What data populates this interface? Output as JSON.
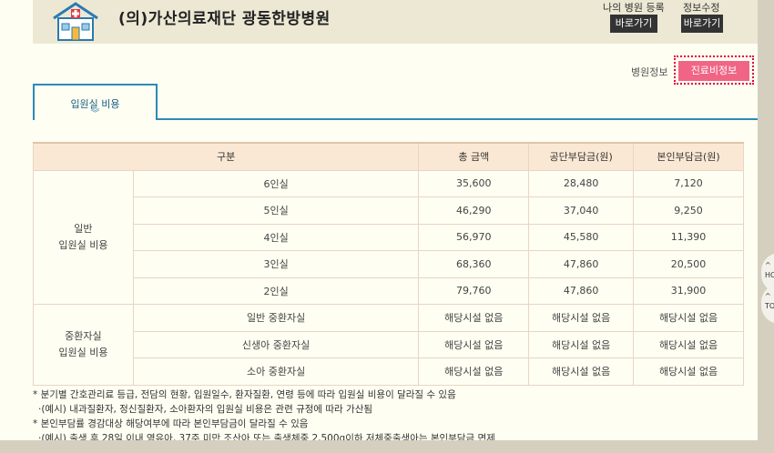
{
  "header": {
    "hospital_name": "(의)가산의료재단 광동한방병원",
    "links": [
      {
        "label": "나의 병원 등록",
        "button": "바로가기"
      },
      {
        "label": "정보수정",
        "button": "바로가기"
      }
    ]
  },
  "info_section": {
    "label": "병원정보",
    "button": "진료비정보"
  },
  "tabs": [
    {
      "label": "입원실 비용",
      "chevron": "︾"
    }
  ],
  "table": {
    "headers": [
      "구분",
      "총 금액",
      "공단부담금(원)",
      "본인부담금(원)"
    ],
    "groups": [
      {
        "name_line1": "일반",
        "name_line2": "입원실 비용",
        "rows": [
          {
            "type": "6인실",
            "total": "35,600",
            "public": "28,480",
            "self": "7,120"
          },
          {
            "type": "5인실",
            "total": "46,290",
            "public": "37,040",
            "self": "9,250"
          },
          {
            "type": "4인실",
            "total": "56,970",
            "public": "45,580",
            "self": "11,390"
          },
          {
            "type": "3인실",
            "total": "68,360",
            "public": "47,860",
            "self": "20,500"
          },
          {
            "type": "2인실",
            "total": "79,760",
            "public": "47,860",
            "self": "31,900"
          }
        ]
      },
      {
        "name_line1": "중환자실",
        "name_line2": "입원실 비용",
        "rows": [
          {
            "type": "일반 중환자실",
            "total": "해당시설 없음",
            "public": "해당시설 없음",
            "self": "해당시설 없음"
          },
          {
            "type": "신생아 중환자실",
            "total": "해당시설 없음",
            "public": "해당시설 없음",
            "self": "해당시설 없음"
          },
          {
            "type": "소아 중환자실",
            "total": "해당시설 없음",
            "public": "해당시설 없음",
            "self": "해당시설 없음"
          }
        ]
      }
    ]
  },
  "notes": [
    "* 분기별 간호관리료 등급, 전담의 현황, 입원일수, 환자질환, 연령 등에 따라 입원실 비용이 달라질 수 있음",
    "·(예시) 내과질환자, 정신질환자, 소아환자의 입원실 비용은 관련 규정에 따라 가산됨",
    "* 본인부담률 경감대상 해당여부에 따라 본인부담금이 달라질 수 있음",
    "·(예시) 출생 후 28일 이내 영유아, 37주 미만 조산아 또는 출생체중 2,500g이하 저체중출생아는 본인부담금 면제"
  ],
  "side_widgets": [
    "HO",
    "TO"
  ],
  "colors": {
    "tab_border": "#2d8ab8",
    "header_row": "#fbe8d4",
    "accent_button": "#f06586",
    "highlight_dotted": "#e0003a"
  }
}
